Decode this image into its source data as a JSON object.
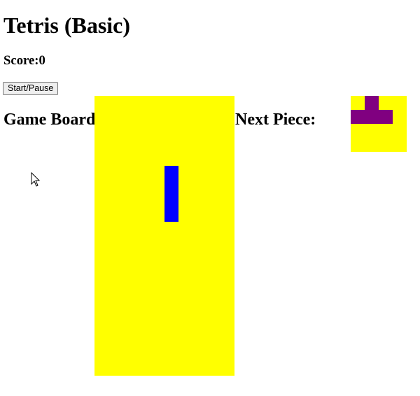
{
  "title": "Tetris (Basic)",
  "score_text": "Score:0",
  "start_button": "Start/Pause",
  "board_label": "Game Board",
  "next_label": "Next Piece:",
  "colors": {
    "background": "#ffff00",
    "active_piece": "#0000ff",
    "next_piece": "#800080"
  },
  "board": {
    "columns": 10,
    "rows": 20,
    "active_piece": {
      "shape": "I",
      "cells": [
        [
          5,
          5
        ],
        [
          5,
          6
        ],
        [
          5,
          7
        ],
        [
          5,
          8
        ]
      ]
    }
  },
  "next_piece": {
    "columns": 4,
    "rows": 4,
    "shape": "T",
    "cells": [
      [
        1,
        0
      ],
      [
        0,
        1
      ],
      [
        1,
        1
      ],
      [
        2,
        1
      ]
    ]
  },
  "cursor_icon": "arrow-cursor-icon"
}
